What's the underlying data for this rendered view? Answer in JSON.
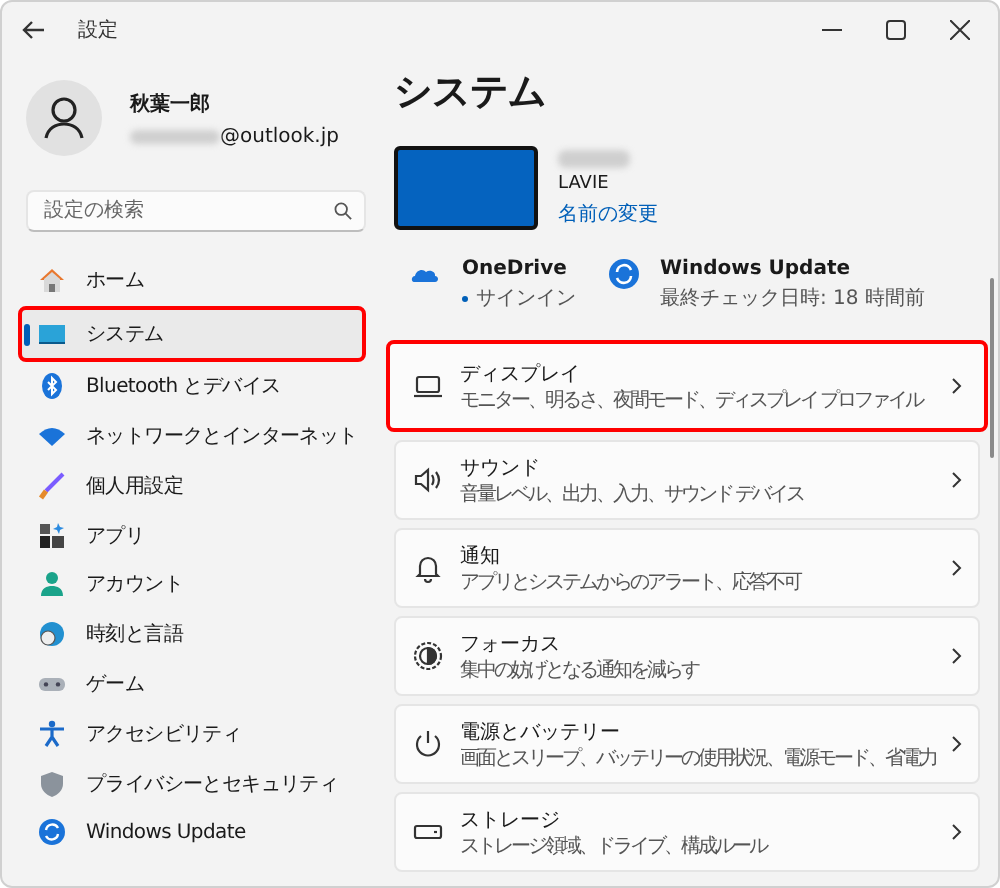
{
  "window": {
    "title": "設定"
  },
  "profile": {
    "name": "秋葉一郎",
    "email_visible": "@outlook.jp"
  },
  "search": {
    "placeholder": "設定の検索"
  },
  "nav": [
    {
      "label": "ホーム",
      "selected": false,
      "highlighted": false
    },
    {
      "label": "システム",
      "selected": true,
      "highlighted": true
    },
    {
      "label": "Bluetooth とデバイス",
      "selected": false,
      "highlighted": false
    },
    {
      "label": "ネットワークとインターネット",
      "selected": false,
      "highlighted": false
    },
    {
      "label": "個人用設定",
      "selected": false,
      "highlighted": false
    },
    {
      "label": "アプリ",
      "selected": false,
      "highlighted": false
    },
    {
      "label": "アカウント",
      "selected": false,
      "highlighted": false
    },
    {
      "label": "時刻と言語",
      "selected": false,
      "highlighted": false
    },
    {
      "label": "ゲーム",
      "selected": false,
      "highlighted": false
    },
    {
      "label": "アクセシビリティ",
      "selected": false,
      "highlighted": false
    },
    {
      "label": "プライバシーとセキュリティ",
      "selected": false,
      "highlighted": false
    },
    {
      "label": "Windows Update",
      "selected": false,
      "highlighted": false
    }
  ],
  "page": {
    "title": "システム",
    "device_model": "LAVIE",
    "rename_link": "名前の変更",
    "status": [
      {
        "title": "OneDrive",
        "subtitle": "サインイン",
        "kind": "account"
      },
      {
        "title": "Windows Update",
        "subtitle": "最終チェック日時: 18 時間前",
        "kind": "update"
      }
    ],
    "settings": [
      {
        "title": "ディスプレイ",
        "subtitle": "モニター、明るさ、夜間モード、ディスプレイ プロファイル",
        "highlighted": true
      },
      {
        "title": "サウンド",
        "subtitle": "音量レベル、出力、入力、サウンド デバイス",
        "highlighted": false
      },
      {
        "title": "通知",
        "subtitle": "アプリとシステムからのアラート、応答不可",
        "highlighted": false
      },
      {
        "title": "フォーカス",
        "subtitle": "集中の妨げとなる通知を減らす",
        "highlighted": false
      },
      {
        "title": "電源とバッテリー",
        "subtitle": "画面とスリープ、バッテリーの使用状況、電源モード、省電力",
        "highlighted": false
      },
      {
        "title": "ストレージ",
        "subtitle": "ストレージ領域、ドライブ、構成ルール",
        "highlighted": false
      }
    ]
  }
}
